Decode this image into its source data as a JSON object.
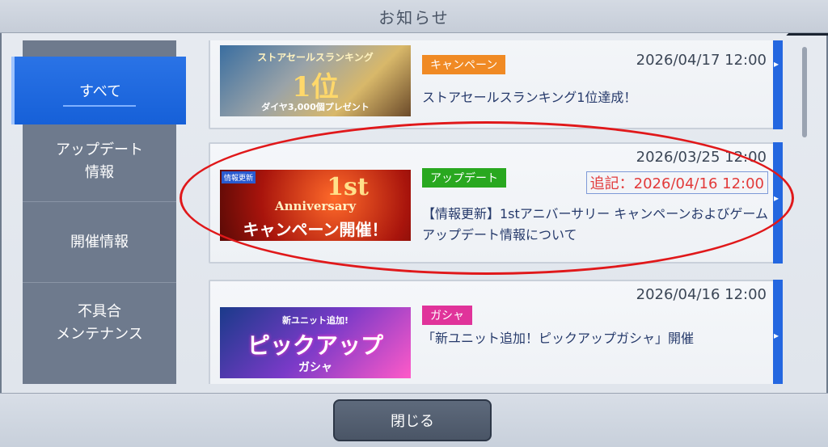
{
  "window": {
    "title": "お知らせ"
  },
  "sidebar": {
    "items": [
      {
        "label": "すべて",
        "active": true
      },
      {
        "label": "アップデート\n情報"
      },
      {
        "label": "開催情報"
      },
      {
        "label": "不具合\nメンテナンス"
      }
    ]
  },
  "notices": [
    {
      "tag": "キャンペーン",
      "tag_color": "#f08a24",
      "date": "2026/04/17 12:00",
      "headline": "ストアセールスランキング1位達成！",
      "banner": {
        "line1": "ストアセールスランキング",
        "line2": "1位",
        "line3": "ダイヤ3,000個プレゼント"
      }
    },
    {
      "tag": "アップデート",
      "tag_color": "#29a81f",
      "date": "2026/03/25 12:00",
      "addendum": "追記：2026/04/16 12:00",
      "headline": "【情報更新】1stアニバーサリー キャンペーンおよびゲームアップデート情報について",
      "banner": {
        "badge": "情報更新",
        "line1": "1st",
        "line2": "Anniversary",
        "line3": "キャンペーン開催！"
      }
    },
    {
      "tag": "ガシャ",
      "tag_color": "#e0339a",
      "date": "2026/04/16 12:00",
      "headline": "「新ユニット追加！ピックアップガシャ」開催",
      "banner": {
        "line1": "新ユニット追加!",
        "line2": "ピックアップ",
        "line3": "ガシャ"
      }
    }
  ],
  "footer": {
    "close_label": "閉じる"
  },
  "colors": {
    "accent": "#1f67de",
    "highlight_ring": "#e0181a"
  }
}
